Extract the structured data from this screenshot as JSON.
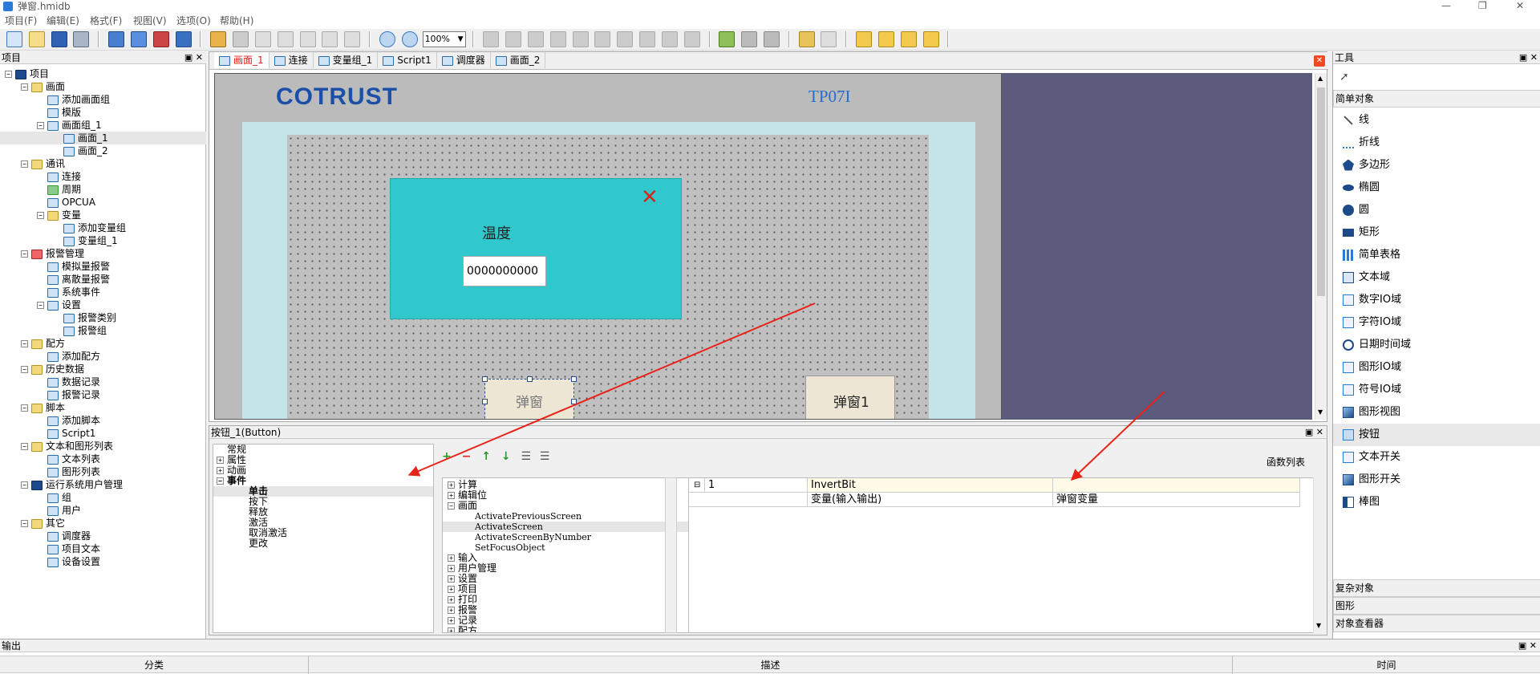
{
  "window": {
    "title": "弹窗.hmidb",
    "controls": [
      "—",
      "❐",
      "✕"
    ]
  },
  "menu": [
    "项目(F)",
    "编辑(E)",
    "格式(F)",
    "视图(V)",
    "选项(O)",
    "帮助(H)"
  ],
  "toolbar": {
    "zoom": "100%"
  },
  "project_panel": {
    "title": "项目",
    "tree": [
      {
        "label": "项目",
        "indent": 0,
        "exp": "-",
        "icon": "d"
      },
      {
        "label": "画面",
        "indent": 1,
        "exp": "-",
        "icon": "f"
      },
      {
        "label": "添加画面组",
        "indent": 2,
        "exp": "",
        "icon": ""
      },
      {
        "label": "模版",
        "indent": 2,
        "exp": "",
        "icon": ""
      },
      {
        "label": "画面组_1",
        "indent": 2,
        "exp": "-",
        "icon": ""
      },
      {
        "label": "画面_1",
        "indent": 3,
        "exp": "",
        "icon": "",
        "selected": true
      },
      {
        "label": "画面_2",
        "indent": 3,
        "exp": "",
        "icon": ""
      },
      {
        "label": "通讯",
        "indent": 1,
        "exp": "-",
        "icon": "f"
      },
      {
        "label": "连接",
        "indent": 2,
        "exp": "",
        "icon": ""
      },
      {
        "label": "周期",
        "indent": 2,
        "exp": "",
        "icon": "g"
      },
      {
        "label": "OPCUA",
        "indent": 2,
        "exp": "",
        "icon": ""
      },
      {
        "label": "变量",
        "indent": 2,
        "exp": "-",
        "icon": "f"
      },
      {
        "label": "添加变量组",
        "indent": 3,
        "exp": "",
        "icon": ""
      },
      {
        "label": "变量组_1",
        "indent": 3,
        "exp": "",
        "icon": ""
      },
      {
        "label": "报警管理",
        "indent": 1,
        "exp": "-",
        "icon": "r"
      },
      {
        "label": "模拟量报警",
        "indent": 2,
        "exp": "",
        "icon": ""
      },
      {
        "label": "离散量报警",
        "indent": 2,
        "exp": "",
        "icon": ""
      },
      {
        "label": "系统事件",
        "indent": 2,
        "exp": "",
        "icon": ""
      },
      {
        "label": "设置",
        "indent": 2,
        "exp": "-",
        "icon": ""
      },
      {
        "label": "报警类别",
        "indent": 3,
        "exp": "",
        "icon": ""
      },
      {
        "label": "报警组",
        "indent": 3,
        "exp": "",
        "icon": ""
      },
      {
        "label": "配方",
        "indent": 1,
        "exp": "-",
        "icon": "f"
      },
      {
        "label": "添加配方",
        "indent": 2,
        "exp": "",
        "icon": ""
      },
      {
        "label": "历史数据",
        "indent": 1,
        "exp": "-",
        "icon": "f"
      },
      {
        "label": "数据记录",
        "indent": 2,
        "exp": "",
        "icon": ""
      },
      {
        "label": "报警记录",
        "indent": 2,
        "exp": "",
        "icon": ""
      },
      {
        "label": "脚本",
        "indent": 1,
        "exp": "-",
        "icon": "f"
      },
      {
        "label": "添加脚本",
        "indent": 2,
        "exp": "",
        "icon": ""
      },
      {
        "label": "Script1",
        "indent": 2,
        "exp": "",
        "icon": ""
      },
      {
        "label": "文本和图形列表",
        "indent": 1,
        "exp": "-",
        "icon": "f"
      },
      {
        "label": "文本列表",
        "indent": 2,
        "exp": "",
        "icon": ""
      },
      {
        "label": "图形列表",
        "indent": 2,
        "exp": "",
        "icon": ""
      },
      {
        "label": "运行系统用户管理",
        "indent": 1,
        "exp": "-",
        "icon": "d"
      },
      {
        "label": "组",
        "indent": 2,
        "exp": "",
        "icon": ""
      },
      {
        "label": "用户",
        "indent": 2,
        "exp": "",
        "icon": ""
      },
      {
        "label": "其它",
        "indent": 1,
        "exp": "-",
        "icon": "f"
      },
      {
        "label": "调度器",
        "indent": 2,
        "exp": "",
        "icon": ""
      },
      {
        "label": "项目文本",
        "indent": 2,
        "exp": "",
        "icon": ""
      },
      {
        "label": "设备设置",
        "indent": 2,
        "exp": "",
        "icon": ""
      }
    ]
  },
  "tabs": [
    {
      "label": "画面_1",
      "active": true
    },
    {
      "label": "连接"
    },
    {
      "label": "变量组_1"
    },
    {
      "label": "Script1"
    },
    {
      "label": "调度器"
    },
    {
      "label": "画面_2"
    }
  ],
  "canvas": {
    "logo": "COTRUST",
    "model": "TP07I",
    "popup_label": "温度",
    "popup_value": "0000000000",
    "button_popup": "弹窗",
    "button_popup1": "弹窗1"
  },
  "props": {
    "title": "按钮_1(Button)",
    "categories": [
      {
        "label": "常规",
        "exp": ""
      },
      {
        "label": "属性",
        "exp": "+"
      },
      {
        "label": "动画",
        "exp": "+"
      },
      {
        "label": "事件",
        "exp": "-",
        "bold": true
      }
    ],
    "events": [
      "单击",
      "按下",
      "释放",
      "激活",
      "取消激活",
      "更改"
    ],
    "func_list_label": "函数列表",
    "func_tree": [
      {
        "label": "计算",
        "exp": "+",
        "indent": 0
      },
      {
        "label": "编辑位",
        "exp": "+",
        "indent": 0
      },
      {
        "label": "画面",
        "exp": "-",
        "indent": 0
      },
      {
        "label": "ActivatePreviousScreen",
        "exp": "",
        "indent": 1
      },
      {
        "label": "ActivateScreen",
        "exp": "",
        "indent": 1,
        "selected": true
      },
      {
        "label": "ActivateScreenByNumber",
        "exp": "",
        "indent": 1
      },
      {
        "label": "SetFocusObject",
        "exp": "",
        "indent": 1
      },
      {
        "label": "输入",
        "exp": "+",
        "indent": 0
      },
      {
        "label": "用户管理",
        "exp": "+",
        "indent": 0
      },
      {
        "label": "设置",
        "exp": "+",
        "indent": 0
      },
      {
        "label": "项目",
        "exp": "+",
        "indent": 0
      },
      {
        "label": "打印",
        "exp": "+",
        "indent": 0
      },
      {
        "label": "报警",
        "exp": "+",
        "indent": 0
      },
      {
        "label": "记录",
        "exp": "+",
        "indent": 0
      },
      {
        "label": "配方",
        "exp": "+",
        "indent": 0
      }
    ],
    "func_grid": {
      "row1": {
        "num": "1",
        "name": "InvertBit",
        "value": ""
      },
      "row2": {
        "param": "变量(输入输出)",
        "value": "弹窗变量"
      }
    }
  },
  "tools": {
    "title": "工具",
    "section": "简单对象",
    "items": [
      {
        "label": "线",
        "icon": "line-icon"
      },
      {
        "label": "折线",
        "icon": "polyline-icon"
      },
      {
        "label": "多边形",
        "icon": "polygon-icon"
      },
      {
        "label": "椭圆",
        "icon": "ellipse-icon"
      },
      {
        "label": "圆",
        "icon": "circle-icon"
      },
      {
        "label": "矩形",
        "icon": "rectangle-icon"
      },
      {
        "label": "简单表格",
        "icon": "table-icon"
      },
      {
        "label": "文本域",
        "icon": "text-icon"
      },
      {
        "label": "数字IO域",
        "icon": "numeric-io-icon"
      },
      {
        "label": "字符IO域",
        "icon": "char-io-icon"
      },
      {
        "label": "日期时间域",
        "icon": "clock-icon"
      },
      {
        "label": "图形IO域",
        "icon": "graphic-io-icon"
      },
      {
        "label": "符号IO域",
        "icon": "symbol-io-icon"
      },
      {
        "label": "图形视图",
        "icon": "picture-icon"
      },
      {
        "label": "按钮",
        "icon": "button-icon",
        "selected": true
      },
      {
        "label": "文本开关",
        "icon": "text-switch-icon"
      },
      {
        "label": "图形开关",
        "icon": "graphic-switch-icon"
      },
      {
        "label": "棒图",
        "icon": "bar-icon"
      }
    ],
    "bottom_sections": [
      "复杂对象",
      "图形",
      "对象查看器"
    ]
  },
  "output": {
    "title": "输出",
    "columns": [
      "分类",
      "描述",
      "时间"
    ]
  }
}
